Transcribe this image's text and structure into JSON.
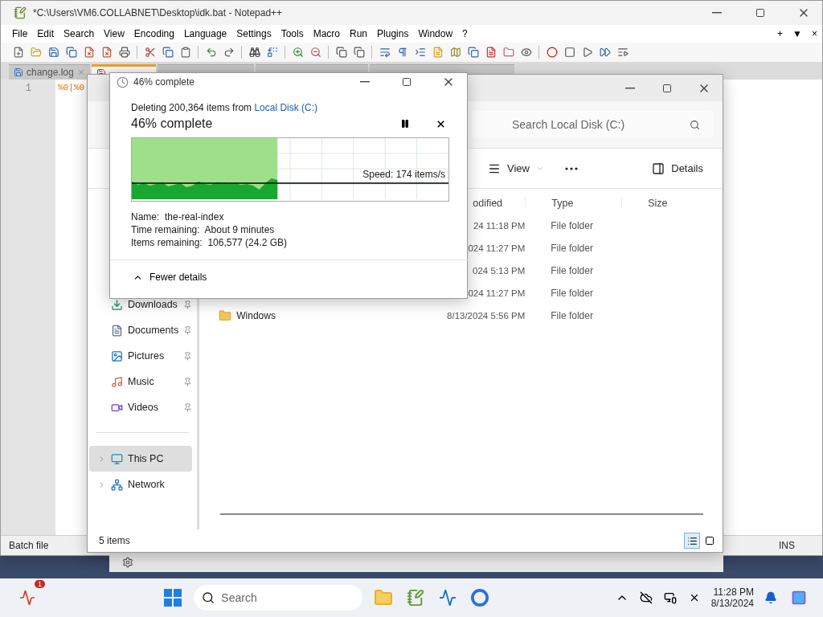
{
  "notepad": {
    "title": "*C:\\Users\\VM6.COLLABNET\\Desktop\\idk.bat - Notepad++",
    "menu": [
      "File",
      "Edit",
      "Search",
      "View",
      "Encoding",
      "Language",
      "Settings",
      "Tools",
      "Macro",
      "Run",
      "Plugins",
      "Window",
      "?"
    ],
    "menu_right": [
      "+",
      "▼",
      "×"
    ],
    "tabs": [
      {
        "label": "change.log",
        "selected": false
      },
      {
        "selected": true
      },
      {
        "selected": false
      },
      {
        "selected": false
      },
      {
        "selected": false
      }
    ],
    "line_number": "1",
    "code_line": "%0|%0",
    "status": {
      "file_type": "Batch file",
      "mode": "INS"
    }
  },
  "explorer": {
    "search": {
      "placeholder": "Search Local Disk (C:)"
    },
    "view_button": "View",
    "details_button": "Details",
    "columns": [
      "odified",
      "Type",
      "Size"
    ],
    "rows": [
      {
        "modified": "24 11:18 PM",
        "type": "File folder"
      },
      {
        "modified": "024 11:27 PM",
        "type": "File folder"
      },
      {
        "modified": "024 5:13 PM",
        "type": "File folder"
      },
      {
        "modified": "024 11:27 PM",
        "type": "File folder"
      },
      {
        "name": "Windows",
        "modified": "8/13/2024 5:56 PM",
        "type": "File folder"
      }
    ],
    "sidebar": [
      {
        "label": "Downloads",
        "kind": "pinned",
        "selected": false
      },
      {
        "label": "Documents",
        "kind": "pinned",
        "selected": false
      },
      {
        "label": "Pictures",
        "kind": "pinned",
        "selected": false
      },
      {
        "label": "Music",
        "kind": "pinned",
        "selected": false
      },
      {
        "label": "Videos",
        "kind": "pinned",
        "selected": false
      },
      {
        "label": "This PC",
        "kind": "location",
        "selected": true
      },
      {
        "label": "Network",
        "kind": "location",
        "selected": false
      }
    ],
    "status": "5 items",
    "view_modes": [
      {
        "selected": true
      },
      {
        "selected": false
      }
    ]
  },
  "dialog": {
    "title": "46% complete",
    "status_prefix": "Deleting 200,364 items from ",
    "location_link": "Local Disk (C:)",
    "heading": "46% complete",
    "progress": {
      "level": 0.46
    },
    "speed": "Speed: 174 items/s",
    "details": [
      {
        "label": "Name:",
        "value": "the-real-index"
      },
      {
        "label": "Time remaining:",
        "value": "About 9 minutes"
      },
      {
        "label": "Items remaining:",
        "value": "106,577 (24.2 GB)"
      }
    ],
    "toggle": "Fewer details"
  },
  "taskbar": {
    "badge": "1",
    "search": {
      "placeholder": "Search"
    },
    "time": "11:28 PM",
    "date": "8/13/2024"
  }
}
